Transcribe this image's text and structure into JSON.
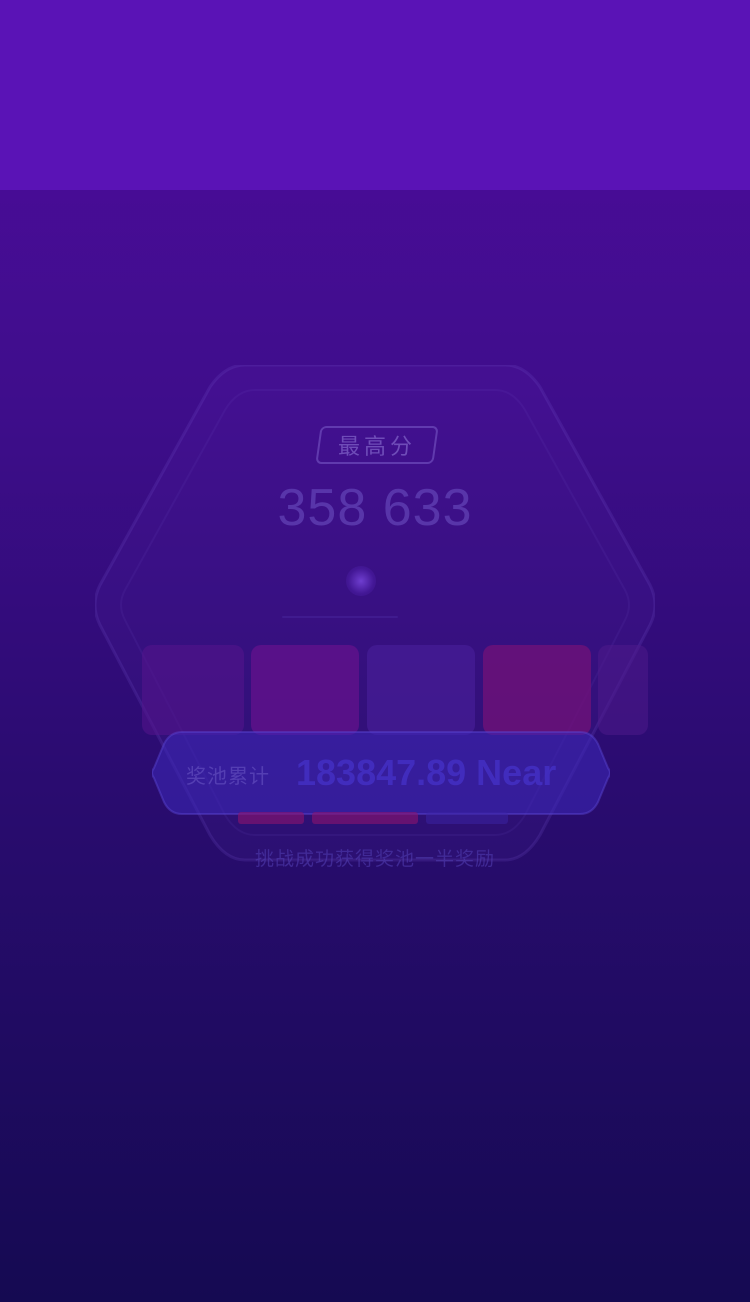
{
  "top_bar": {},
  "card": {
    "best_label": "最高分",
    "best_score": "358 633",
    "tiles": [
      "tile-1",
      "tile-2",
      "tile-3",
      "tile-4",
      "tile-5"
    ]
  },
  "prize_pool": {
    "label": "奖池累计",
    "value": "183847.89 Near"
  },
  "hint": "挑战成功获得奖池一半奖励",
  "colors": {
    "top_bar": "#5a13b6",
    "bg_top": "#4f0c9e",
    "bg_bottom": "#150a52",
    "pool_value": "#4632c8"
  }
}
